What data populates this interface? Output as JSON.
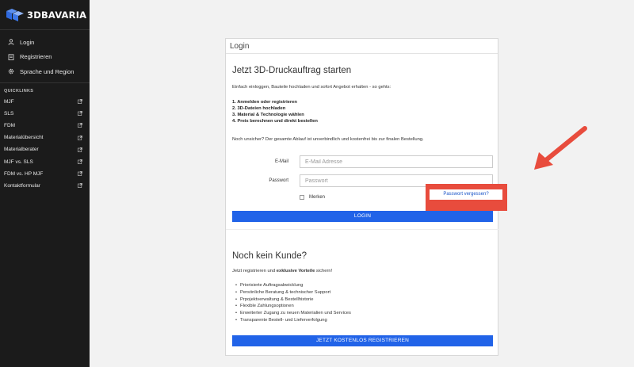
{
  "brand": {
    "name": "3DBAVARIA"
  },
  "sidebar": {
    "nav": [
      {
        "label": "Login",
        "icon": "user-icon"
      },
      {
        "label": "Registrieren",
        "icon": "clipboard-icon"
      },
      {
        "label": "Sprache und Region",
        "icon": "gear-icon"
      }
    ],
    "quicklinks_title": "QUICKLINKS",
    "quicklinks": [
      {
        "label": "MJF"
      },
      {
        "label": "SLS"
      },
      {
        "label": "FDM"
      },
      {
        "label": "Materialübersicht"
      },
      {
        "label": "Materialberater"
      },
      {
        "label": "MJF vs. SLS"
      },
      {
        "label": "FDM vs. HP MJF"
      },
      {
        "label": "Kontaktformular"
      }
    ]
  },
  "login": {
    "card_title": "Login",
    "heading": "Jetzt 3D-Druckauftrag starten",
    "intro": "Einfach einloggen, Bauteile hochladen und sofort Angebot erhalten - so gehts:",
    "steps": [
      "1. Anmelden oder registrieren",
      "2. 3D-Dateien hochladen",
      "3. Material & Technologie wählen",
      "4. Preis berechnen und direkt bestellen"
    ],
    "note": "Noch unsicher? Der gesamte Ablauf ist unverbindlich und kostenfrei bis zur finalen Bestellung.",
    "email_label": "E-Mail",
    "email_placeholder": "E-Mail Adresse",
    "email_value": "",
    "password_label": "Passwort",
    "password_placeholder": "Passwort",
    "password_value": "",
    "remember_label": "Merken",
    "forgot_label": "Passwort vergessen?",
    "submit_label": "LOGIN"
  },
  "register": {
    "heading": "Noch kein Kunde?",
    "intro_prefix": "Jetzt registrieren und ",
    "intro_bold": "exklusive Vorteile",
    "intro_suffix": " sichern!",
    "benefits": [
      "Priorisierte Auftragsabwicklung",
      "Persönliche Beratung & technischer Support",
      "Prpojektverwaltung & Bestellhistorie",
      "Flexible Zahlungsoptionen",
      "Erweiterter Zugang zu neuen Materialien und Services",
      "Transparente Bestell- und Lieferverfolgung"
    ],
    "submit_label": "JETZT KOSTENLOS REGISTRIEREN"
  },
  "colors": {
    "accent": "#2163e8",
    "highlight": "#e84c3d",
    "sidebar": "#1b1b1b"
  }
}
